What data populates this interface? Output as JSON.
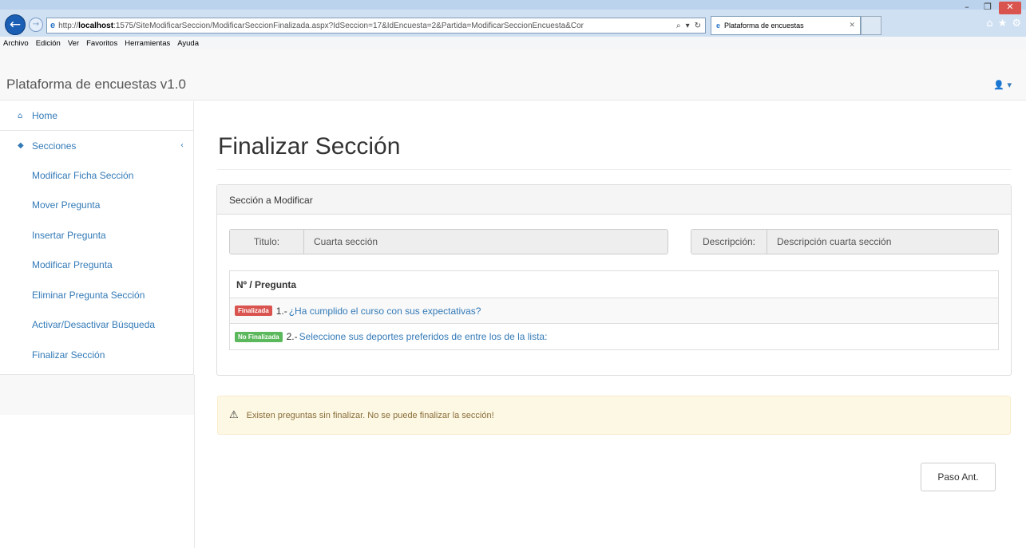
{
  "browser": {
    "url_prefix": "http://",
    "url_host": "localhost",
    "url_rest": ":1575/SiteModificarSeccion/ModificarSeccionFinalizada.aspx?IdSeccion=17&IdEncuesta=2&Partida=ModificarSeccionEncuesta&Cor",
    "tab_title": "Plataforma de encuestas",
    "menu": [
      "Archivo",
      "Edición",
      "Ver",
      "Favoritos",
      "Herramientas",
      "Ayuda"
    ]
  },
  "app": {
    "brand": "Plataforma de encuestas v1.0"
  },
  "sidebar": {
    "home": "Home",
    "secciones": "Secciones",
    "items": [
      "Modificar Ficha Sección",
      "Mover Pregunta",
      "Insertar Pregunta",
      "Modificar Pregunta",
      "Eliminar Pregunta Sección",
      "Activar/Desactivar Búsqueda",
      "Finalizar Sección"
    ]
  },
  "main": {
    "title": "Finalizar Sección",
    "panel_heading": "Sección a Modificar",
    "titulo_label": "Titulo:",
    "titulo_value": "Cuarta sección",
    "descripcion_label": "Descripción:",
    "descripcion_value": "Descripción cuarta sección",
    "table_header": "Nº / Pregunta",
    "questions": [
      {
        "status": "Finalizada",
        "num": "1.-",
        "text": "¿Ha cumplido el curso con sus expectativas?"
      },
      {
        "status": "No Finalizada",
        "num": "2.-",
        "text": "Seleccione sus deportes preferidos de entre los de la lista:"
      }
    ],
    "alert": "Existen preguntas sin finalizar. No se puede finalizar la sección!",
    "back_button": "Paso Ant."
  },
  "colors": {
    "link": "#337ab7",
    "danger": "#d9534f",
    "success": "#5cb85c",
    "warning_bg": "#fcf8e3"
  }
}
